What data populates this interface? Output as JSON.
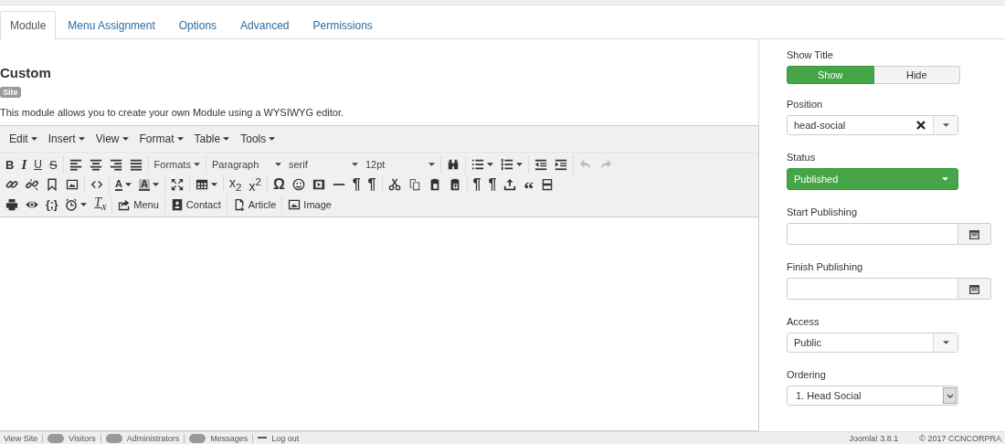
{
  "tabs": [
    {
      "label": "Module",
      "selected": true
    },
    {
      "label": "Menu Assignment",
      "selected": false
    },
    {
      "label": "Options",
      "selected": false
    },
    {
      "label": "Advanced",
      "selected": false
    },
    {
      "label": "Permissions",
      "selected": false
    }
  ],
  "module": {
    "title": "Custom",
    "badge": "Site",
    "description": "This module allows you to create your own Module using a WYSIWYG editor."
  },
  "editor": {
    "menubar": [
      "Edit",
      "Insert",
      "View",
      "Format",
      "Table",
      "Tools"
    ],
    "toolbar": [
      [
        {
          "kind": "bold",
          "text": "B",
          "disabled": false
        },
        {
          "kind": "italic",
          "text": "I",
          "disabled": false
        },
        {
          "kind": "underline",
          "text": "U",
          "disabled": false
        },
        {
          "kind": "strike",
          "text": "S",
          "disabled": false
        },
        {
          "kind": "sep"
        },
        {
          "kind": "alignleft",
          "disabled": false
        },
        {
          "kind": "aligncenter",
          "disabled": false
        },
        {
          "kind": "alignright",
          "disabled": false
        },
        {
          "kind": "justify",
          "disabled": false
        },
        {
          "kind": "sep"
        },
        {
          "kind": "formats",
          "text": "Formats",
          "caret": true,
          "disabled": false
        },
        {
          "kind": "sep"
        },
        {
          "kind": "select",
          "text": "Paragraph",
          "disabled": false
        },
        {
          "kind": "select",
          "text": "serif",
          "disabled": false
        },
        {
          "kind": "select",
          "text": "12pt",
          "disabled": false
        },
        {
          "kind": "sep"
        },
        {
          "kind": "find",
          "disabled": false
        },
        {
          "kind": "sep"
        },
        {
          "kind": "bullist",
          "caret": true,
          "disabled": false
        },
        {
          "kind": "numlist",
          "caret": true,
          "disabled": false
        },
        {
          "kind": "sep"
        },
        {
          "kind": "outdent",
          "disabled": false
        },
        {
          "kind": "indent",
          "disabled": false
        },
        {
          "kind": "sep"
        },
        {
          "kind": "undo",
          "disabled": true
        },
        {
          "kind": "redo",
          "disabled": true
        }
      ],
      [
        {
          "kind": "link",
          "disabled": false
        },
        {
          "kind": "unlink",
          "disabled": false
        },
        {
          "kind": "bookmark",
          "disabled": false
        },
        {
          "kind": "image",
          "disabled": false
        },
        {
          "kind": "sep"
        },
        {
          "kind": "code",
          "disabled": false
        },
        {
          "kind": "sep"
        },
        {
          "kind": "forecolor",
          "text": "A",
          "caret": true,
          "disabled": false
        },
        {
          "kind": "backcolor",
          "text": "A",
          "caret": true,
          "disabled": false
        },
        {
          "kind": "sep"
        },
        {
          "kind": "fullscreen",
          "disabled": false
        },
        {
          "kind": "sep"
        },
        {
          "kind": "table",
          "caret": true,
          "disabled": false
        },
        {
          "kind": "sep"
        },
        {
          "kind": "sub",
          "text": "x$_{2}$",
          "disabled": false
        },
        {
          "kind": "sup",
          "text": "x$^{2}$",
          "disabled": false
        },
        {
          "kind": "sep"
        },
        {
          "kind": "omega",
          "text": "Ω",
          "disabled": false
        },
        {
          "kind": "smiley",
          "disabled": false
        },
        {
          "kind": "media",
          "disabled": false
        },
        {
          "kind": "hr",
          "disabled": false
        },
        {
          "kind": "para",
          "text": "¶",
          "disabled": false
        },
        {
          "kind": "para",
          "text": "¶",
          "disabled": false
        },
        {
          "kind": "sep"
        },
        {
          "kind": "cut",
          "disabled": false
        },
        {
          "kind": "copy",
          "disabled": false
        },
        {
          "kind": "paste",
          "disabled": false
        },
        {
          "kind": "pastetext",
          "disabled": false
        },
        {
          "kind": "sep"
        },
        {
          "kind": "para",
          "text": "¶",
          "disabled": false
        },
        {
          "kind": "para",
          "text": "¶",
          "disabled": false
        },
        {
          "kind": "template",
          "disabled": false
        },
        {
          "kind": "quote",
          "text": "“",
          "disabled": false
        },
        {
          "kind": "pagebreak",
          "disabled": false
        }
      ],
      [
        {
          "kind": "print",
          "disabled": false
        },
        {
          "kind": "preview",
          "disabled": false
        },
        {
          "kind": "codesample",
          "text": "{;}",
          "disabled": false
        },
        {
          "kind": "clock",
          "caret": true,
          "disabled": false
        },
        {
          "kind": "clear",
          "text": "T$_{x}$",
          "disabled": false
        },
        {
          "kind": "sep"
        },
        {
          "kind": "menubtn",
          "text": "Menu",
          "disabled": false
        },
        {
          "kind": "sep"
        },
        {
          "kind": "contactbtn",
          "text": "Contact",
          "disabled": false
        },
        {
          "kind": "sep"
        },
        {
          "kind": "articlebtn",
          "text": "Article",
          "disabled": false
        },
        {
          "kind": "sep"
        },
        {
          "kind": "imagebtn",
          "text": "Image",
          "disabled": false
        }
      ]
    ]
  },
  "sidebar": {
    "show_title": {
      "label": "Show Title",
      "options": [
        {
          "label": "Show",
          "selected": true
        },
        {
          "label": "Hide",
          "selected": false
        }
      ]
    },
    "position": {
      "label": "Position",
      "value": "head-social"
    },
    "status": {
      "label": "Status",
      "value": "Published"
    },
    "start_publishing": {
      "label": "Start Publishing"
    },
    "finish_publishing": {
      "label": "Finish Publishing"
    },
    "access": {
      "label": "Access",
      "value": "Public"
    },
    "ordering": {
      "label": "Ordering",
      "value": "1. Head Social"
    }
  },
  "status_bar": {
    "left": [
      {
        "kind": "link",
        "text": "View Site"
      },
      {
        "kind": "badge",
        "text": "Visitors"
      },
      {
        "kind": "badge",
        "text": "Administrators"
      },
      {
        "kind": "badge",
        "text": "Messages"
      },
      {
        "kind": "logout",
        "text": "Log out"
      }
    ],
    "right": [
      "Joomla! 3.8.1",
      "© 2017 CCNCORPRA"
    ]
  }
}
